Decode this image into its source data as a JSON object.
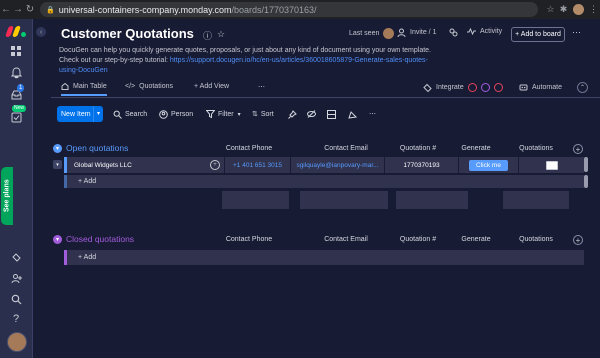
{
  "browser": {
    "back": "←",
    "forward": "→",
    "reload": "↻",
    "lock": "🔒",
    "url_host": "universal-containers-company.monday.com",
    "url_path": "/boards/1770370163/",
    "star": "☆",
    "extension": "✱",
    "menu": "⋮"
  },
  "rail": {
    "notifications_badge": "1",
    "new_label": "New",
    "see_plans": "See plans",
    "help": "?",
    "collapse": "‹"
  },
  "header": {
    "title": "Customer Quotations",
    "info": "ⓘ",
    "star": "☆",
    "last_seen": "Last seen",
    "invite": "Invite / 1",
    "activity": "Activity",
    "add_to_board": "+ Add to board",
    "more": "⋯",
    "description_line1": "DocuGen can help you quickly generate quotes, proposals, or just about any kind of document using your own template.",
    "description_line2_prefix": "Check out our step-by-step tutorial: ",
    "description_link": "https://support.docugen.io/hc/en-us/articles/360018605879-Generate-sales-quotes-using-DocuGen"
  },
  "tabs": {
    "main_table": "Main Table",
    "quotations": "Quotations",
    "add_view": "+ Add View",
    "more": "⋯",
    "integrate": "Integrate",
    "automate": "Automate",
    "collapse": "⌃"
  },
  "toolbar": {
    "new_item": "New Item",
    "new_item_arrow": "▾",
    "search": "Search",
    "person": "Person",
    "filter": "Filter",
    "filter_arrow": "▾",
    "sort": "Sort"
  },
  "columns": {
    "contact_phone": "Contact Phone",
    "contact_email": "Contact Email",
    "quotation_number": "Quotation #",
    "generate": "Generate",
    "quotations": "Quotations",
    "add": "+"
  },
  "groups": [
    {
      "title": "Open quotations",
      "color": "#579bfc",
      "rows": [
        {
          "name": "Global Widgets LLC",
          "phone": "+1 401 651 3015",
          "email": "sgilquayle@ianpovary-mar...",
          "quotation_number": "1770370193",
          "generate_button": "Click me"
        }
      ],
      "add_label": "+ Add"
    },
    {
      "title": "Closed quotations",
      "color": "#a25ddc",
      "rows": [],
      "add_label": "+ Add"
    }
  ],
  "colors": {
    "accent": "#0073ea",
    "background": "#181b34",
    "rail": "#292f4c",
    "row": "#30324e",
    "generate_button": "#579bfc"
  }
}
